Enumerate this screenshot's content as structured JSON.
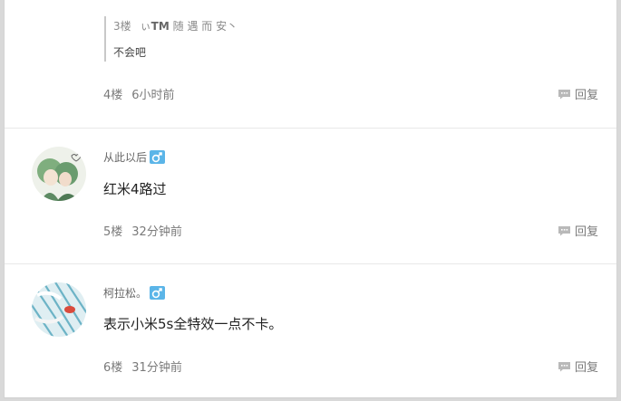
{
  "colors": {
    "gender_badge": "#5bb5e8",
    "reply_icon": "#b9b9b9",
    "divider": "#e8e8e8"
  },
  "comments": [
    {
      "floor": "4楼",
      "time": "6小时前",
      "reply_label": "回复",
      "sub_reply": {
        "floor": "3楼",
        "user_prefix": "ぃ",
        "user_bold": "TM",
        "user_rest": "随 遇 而 安丶",
        "text": "不会吧"
      }
    },
    {
      "username": "从此以后",
      "gender_icon": "male-icon",
      "text": "红米4路过",
      "floor": "5楼",
      "time": "32分钟前",
      "reply_label": "回复"
    },
    {
      "username": "柯拉松。",
      "gender_icon": "male-icon",
      "text": "表示小米5s全特效一点不卡。",
      "floor": "6楼",
      "time": "31分钟前",
      "reply_label": "回复"
    }
  ]
}
